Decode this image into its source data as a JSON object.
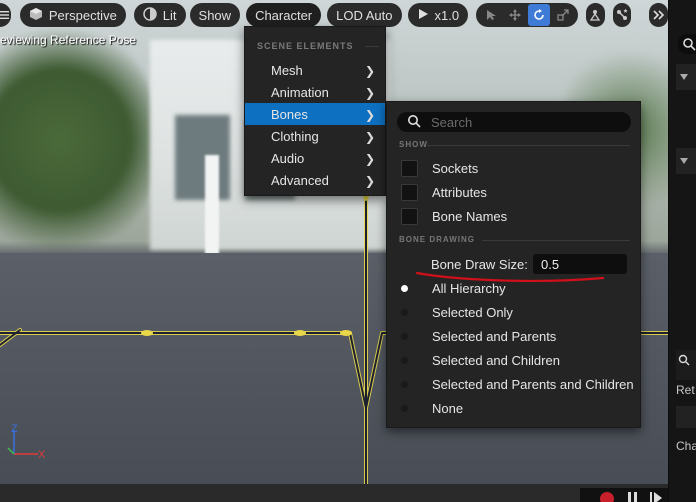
{
  "toolbar": {
    "hamburger_icon": "menu-icon",
    "perspective_label": "Perspective",
    "lit_label": "Lit",
    "show_label": "Show",
    "character_label": "Character",
    "lod_label": "LOD Auto",
    "play_rate_label": "x1.0",
    "more_icon": "chevron-double-right-icon"
  },
  "viewport": {
    "status_text": "eviewing Reference Pose",
    "axis_labels": {
      "z": "Z",
      "x": "X"
    }
  },
  "character_menu": {
    "section_header": "SCENE ELEMENTS",
    "items": [
      {
        "label": "Mesh"
      },
      {
        "label": "Animation"
      },
      {
        "label": "Bones"
      },
      {
        "label": "Clothing"
      },
      {
        "label": "Audio"
      },
      {
        "label": "Advanced"
      }
    ],
    "highlighted": "Bones"
  },
  "bones_menu": {
    "search_placeholder": "Search",
    "show_header": "SHOW",
    "show_items": [
      {
        "label": "Sockets",
        "checked": false
      },
      {
        "label": "Attributes",
        "checked": false
      },
      {
        "label": "Bone Names",
        "checked": false
      }
    ],
    "bone_drawing_header": "BONE DRAWING",
    "bone_draw_size_label": "Bone Draw Size:",
    "bone_draw_size_value": "0.5",
    "drawing_options": [
      {
        "label": "All Hierarchy",
        "selected": true
      },
      {
        "label": "Selected Only",
        "selected": false
      },
      {
        "label": "Selected and Parents",
        "selected": false
      },
      {
        "label": "Selected and Children",
        "selected": false
      },
      {
        "label": "Selected and Parents and Children",
        "selected": false
      },
      {
        "label": "None",
        "selected": false
      }
    ]
  },
  "right_panel": {
    "label_ret": "Ret",
    "label_cha": "Cha"
  },
  "colors": {
    "accent": "#0e70c0",
    "annotation_underline": "#d0101a",
    "bone_yellow": "#e8d84a",
    "record": "#c8202a"
  }
}
